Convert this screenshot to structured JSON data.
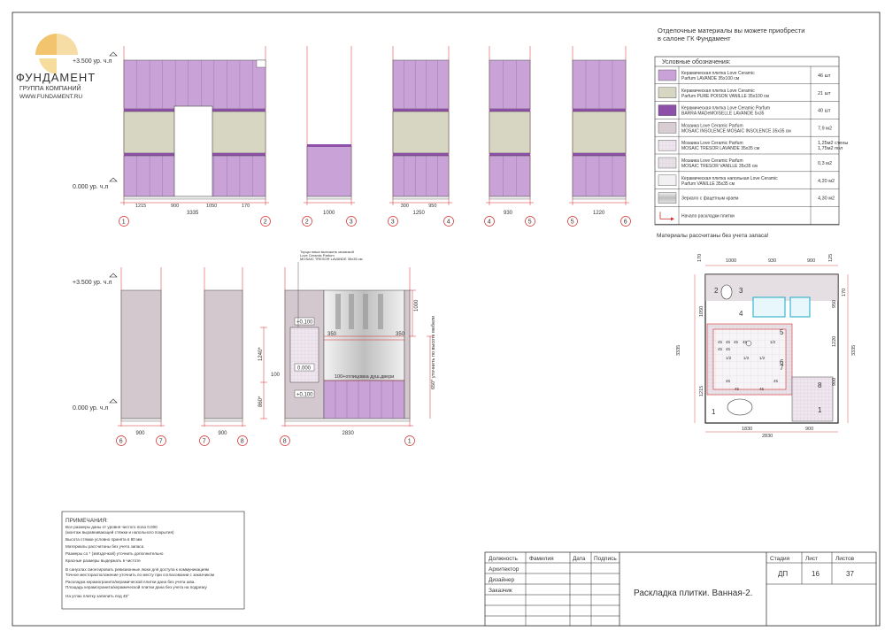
{
  "logo": {
    "name": "ФУНДАМЕНТ",
    "sub": "ГРУППА КОМПАНИЙ",
    "url": "WWW.FUNDAMENT.RU"
  },
  "colors": {
    "lavande": "#c9a3d8",
    "vanille": "#d6d6c3",
    "barra": "#8e4fa8",
    "insolence": "#d8cdd2",
    "tresor": "#e7dfe7",
    "floor": "#f2f0f2",
    "mirror": "#bdbdbd",
    "red": "#d42a2a"
  },
  "levels": {
    "top": "+3.500 ур. ч.л",
    "bottom": "0.000 ур. ч.л"
  },
  "materials_note": {
    "line1": "Отделочные материалы вы можете приобрести",
    "line2": "в салоне ГК Фундамент"
  },
  "legend": {
    "title": "Условные обозначения:",
    "items": [
      {
        "line1": "Керамическая плитка Love Ceramic",
        "line2": "Parfum LAVANDE 35x100 см",
        "qty1": "46 шт",
        "qty2": "",
        "swatch": "lavande"
      },
      {
        "line1": "Керамическая плитка Love Ceramic",
        "line2": "Parfum PURE POISON VANILLE 35x100 см",
        "qty1": "21 шт",
        "qty2": "",
        "swatch": "vanille"
      },
      {
        "line1": "Керамическая плитка Love Ceramic Parfum",
        "line2": "BARRA MADeMOISELLE LAVANDE 5x35",
        "qty1": "40 шт",
        "qty2": "",
        "swatch": "barra"
      },
      {
        "line1": "Мозаика Love Ceramic Parfum",
        "line2": "MOSAIC INSOLENCE MOSAIC INSOLENCE 35x35 см",
        "qty1": "7,9 м2",
        "qty2": "",
        "swatch": "insolence"
      },
      {
        "line1": "Мозаика Love Ceramic Parfum",
        "line2": "MOSAIC TRESOR LAVANDE 35x35 см",
        "qty1": "1,25м2 стены",
        "qty2": "1,75м2 пол",
        "swatch": "tresor"
      },
      {
        "line1": "Мозаика Love Ceramic Parfum",
        "line2": "MOSAIC TRESOR VANILLE 35x35 см",
        "qty1": "0,3 м2",
        "qty2": "",
        "swatch": "tresor2"
      },
      {
        "line1": "Керамическая плитка напольная Love Ceramic",
        "line2": "Parfum VANILLE 35x35 см",
        "qty1": "4,20 м2",
        "qty2": "",
        "swatch": "floor"
      },
      {
        "line1": "Зеркало с фацетным краем",
        "line2": "",
        "qty1": "4,30 м2",
        "qty2": "",
        "swatch": "mirror"
      },
      {
        "line1": "Начало раскладки плитки",
        "line2": "",
        "qty1": "",
        "qty2": "",
        "swatch": "arrow"
      }
    ],
    "footnote": "Материалы рассчитаны без учета запаса!"
  },
  "elevations_top": [
    {
      "dims": [
        "1215",
        "900",
        "1050",
        "170"
      ],
      "total": "3335",
      "axes": [
        "1",
        "2"
      ]
    },
    {
      "dims": [
        "1000"
      ],
      "total": "",
      "axes": [
        "2",
        "3"
      ]
    },
    {
      "dims": [
        "300",
        "950"
      ],
      "total": "1250",
      "axes": [
        "3",
        "4"
      ]
    },
    {
      "dims": [
        "930"
      ],
      "total": "",
      "axes": [
        "4",
        "5"
      ]
    },
    {
      "dims": [
        "1220"
      ],
      "total": "",
      "axes": [
        "5",
        "6"
      ]
    }
  ],
  "elevations_bottom": [
    {
      "dims": [
        "900"
      ],
      "axes": [
        "6",
        "7"
      ]
    },
    {
      "dims": [
        "900"
      ],
      "axes": [
        "7",
        "8"
      ]
    },
    {
      "dims": [
        "2830"
      ],
      "axes": [
        "8",
        "1"
      ]
    }
  ],
  "wall8": {
    "callout1": "Торцы ниши выложить мозаикой",
    "callout2": "Love Ceramic Parfum",
    "callout3": "MOSAIC TRESOR LAVANDE 35x35 см",
    "levels": [
      "+0.100",
      "0.000",
      "+0.100"
    ],
    "dims_left": [
      "1240*",
      "860*"
    ],
    "dim_350a": "350",
    "dim_350b": "350",
    "dim_100": "100",
    "dim_1000": "1000",
    "shower_note": "100+отлицовка душ.двери",
    "furniture_note": "650* уточнить по высоте мебели"
  },
  "plan": {
    "top_dims": [
      "170",
      "1000",
      "930",
      "900",
      "125"
    ],
    "right_dims": [
      "170",
      "950",
      "1220",
      "900"
    ],
    "left_dims": [
      "1050",
      "3335",
      "1215"
    ],
    "bottom_dims": [
      "1830",
      "900",
      "2830"
    ],
    "axis_labels": [
      "2",
      "3",
      "4",
      "5",
      "6",
      "7",
      "8",
      "1"
    ],
    "inner_marks": [
      "45",
      "45",
      "45",
      "45",
      "45",
      "45",
      "1/2",
      "1/2",
      "1/2",
      "1/2",
      "45",
      "45",
      "45",
      "45"
    ]
  },
  "notes": {
    "title": "ПРИМЕЧАНИЯ:",
    "lines": [
      "Все размеры даны от уровня чистого пола 0.000",
      "(монтаж выравнивающей стяжки и напольного покрытия)",
      "Высота стяжки условно принята в 80 мм",
      "Материалы рассчитаны без учета запаса",
      "Размеры со * (звёздочкой) уточнить дополнительно",
      "Красные размеры выдержать в чистоте",
      "В санузлах смонтировать ревизионные люки для доступа к коммуникациям",
      "Точное месторасположение уточнить по месту при согласовании с заказчиком",
      "Раскладка керамогранита/керамической плитки дана без учета шва.",
      "Площадь керамогранита/керамической плитки дана без учета на подрезку",
      "На углах плитку запилить под 45°"
    ]
  },
  "stamp": {
    "headers": [
      "Должность",
      "Фамилия",
      "Дата",
      "Подпись"
    ],
    "roles": [
      "Архитектор",
      "Дизайнер",
      "Заказчик"
    ],
    "stage_header": "Стадия",
    "sheet_header": "Лист",
    "sheets_header": "Листов",
    "stage": "ДП",
    "sheet": "16",
    "sheets": "37",
    "title": "Раскладка плитки. Ванная-2."
  }
}
